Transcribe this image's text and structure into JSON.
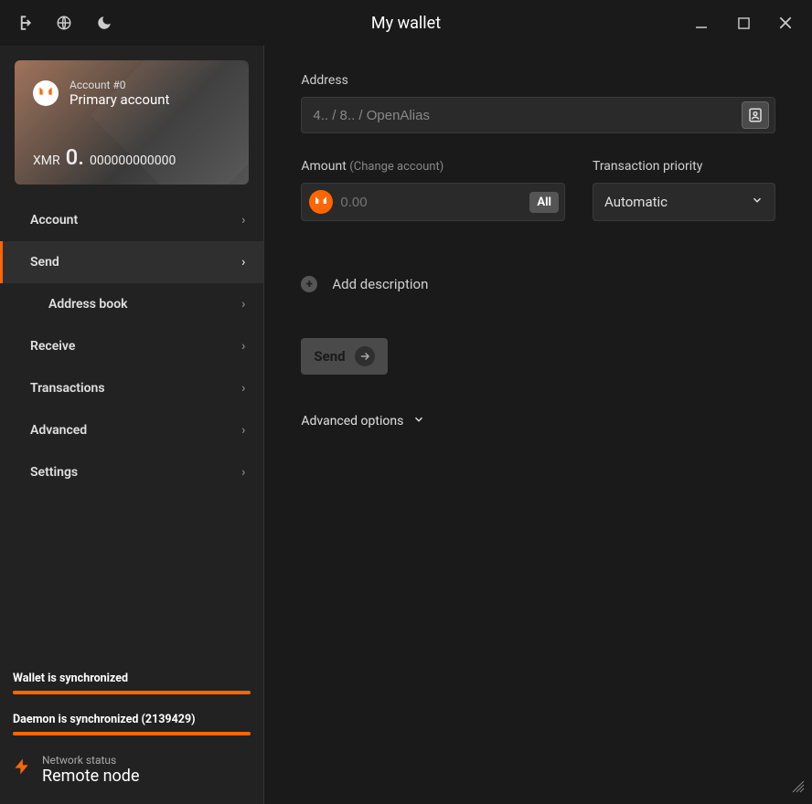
{
  "titlebar": {
    "title": "My wallet"
  },
  "account": {
    "sub": "Account #0",
    "name": "Primary account",
    "currency": "XMR",
    "balance_int": "0.",
    "balance_frac": "000000000000"
  },
  "nav": {
    "account": "Account",
    "send": "Send",
    "address_book": "Address book",
    "receive": "Receive",
    "transactions": "Transactions",
    "advanced": "Advanced",
    "settings": "Settings"
  },
  "sync": {
    "wallet": "Wallet is synchronized",
    "daemon": "Daemon is synchronized (2139429)",
    "net_label": "Network status",
    "net_value": "Remote node"
  },
  "form": {
    "address_label": "Address",
    "address_placeholder": "4.. / 8.. / OpenAlias",
    "amount_label": "Amount",
    "amount_sub": "(Change account)",
    "amount_placeholder": "0.00",
    "all": "All",
    "priority_label": "Transaction priority",
    "priority_value": "Automatic",
    "add_desc": "Add description",
    "send": "Send",
    "advanced": "Advanced options"
  }
}
